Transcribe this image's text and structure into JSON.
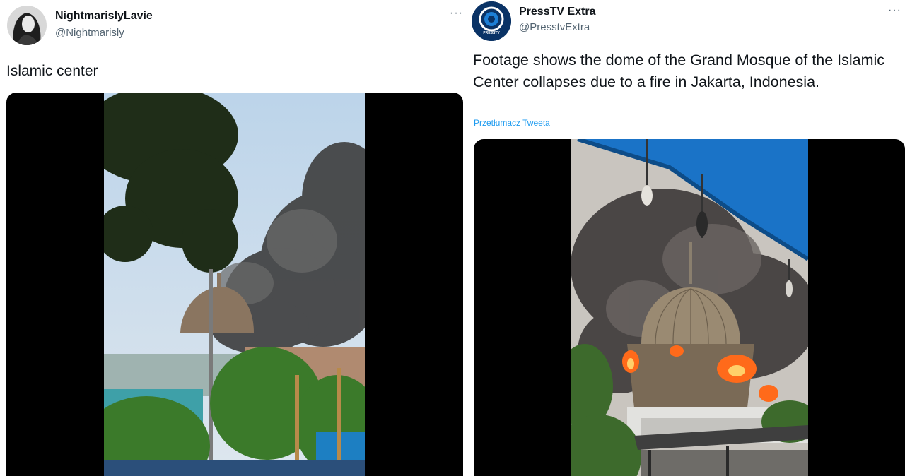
{
  "tweets": [
    {
      "display_name": "NightmarislyLavie",
      "handle": "@Nightmarisly",
      "more_label": "···",
      "text": "Islamic center"
    },
    {
      "display_name": "PressTV Extra",
      "handle": "@PresstvExtra",
      "more_label": "···",
      "text": "Footage shows the dome of the Grand Mosque of the Islamic Center collapses due to a fire in Jakarta, Indonesia.",
      "translate_label": "Przetłumacz Tweeta",
      "avatar_logo_text": "PRESSTV"
    }
  ],
  "colors": {
    "text_primary": "#0f1419",
    "text_secondary": "#536471",
    "link": "#1d9bf0"
  }
}
